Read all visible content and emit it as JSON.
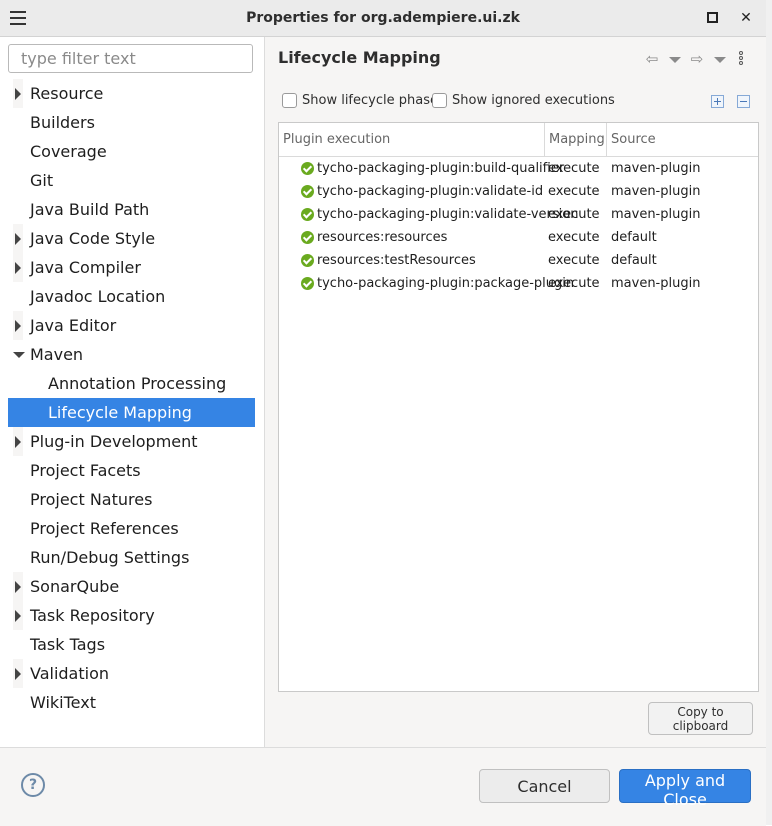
{
  "window": {
    "title": "Properties for org.adempiere.ui.zk",
    "menu_icon": "hamburger-icon",
    "maximize_icon": "maximize-icon",
    "close_icon": "close-icon",
    "close_glyph": "✕"
  },
  "sidebar": {
    "filter_placeholder": "type filter text",
    "items": [
      {
        "label": "Resource",
        "expander": "collapsed"
      },
      {
        "label": "Builders",
        "expander": "none"
      },
      {
        "label": "Coverage",
        "expander": "none"
      },
      {
        "label": "Git",
        "expander": "none"
      },
      {
        "label": "Java Build Path",
        "expander": "none"
      },
      {
        "label": "Java Code Style",
        "expander": "collapsed"
      },
      {
        "label": "Java Compiler",
        "expander": "collapsed"
      },
      {
        "label": "Javadoc Location",
        "expander": "none"
      },
      {
        "label": "Java Editor",
        "expander": "collapsed"
      },
      {
        "label": "Maven",
        "expander": "expanded"
      },
      {
        "label": "Annotation Processing",
        "expander": "none",
        "child": true
      },
      {
        "label": "Lifecycle Mapping",
        "expander": "none",
        "child": true,
        "selected": true
      },
      {
        "label": "Plug-in Development",
        "expander": "collapsed"
      },
      {
        "label": "Project Facets",
        "expander": "none"
      },
      {
        "label": "Project Natures",
        "expander": "none"
      },
      {
        "label": "Project References",
        "expander": "none"
      },
      {
        "label": "Run/Debug Settings",
        "expander": "none"
      },
      {
        "label": "SonarQube",
        "expander": "collapsed"
      },
      {
        "label": "Task Repository",
        "expander": "collapsed"
      },
      {
        "label": "Task Tags",
        "expander": "none"
      },
      {
        "label": "Validation",
        "expander": "collapsed"
      },
      {
        "label": "WikiText",
        "expander": "none"
      }
    ]
  },
  "page": {
    "title": "Lifecycle Mapping",
    "nav": {
      "back_icon": "back-arrow-icon",
      "forward_icon": "forward-arrow-icon",
      "back_glyph": "⇦",
      "forward_glyph": "⇨"
    },
    "options": {
      "show_lifecycle_phases": {
        "label": "Show lifecycle phases",
        "checked": false
      },
      "show_ignored_executions": {
        "label": "Show ignored executions",
        "checked": false
      }
    },
    "tools": {
      "expand_all_icon": "expand-all-icon",
      "collapse_all_icon": "collapse-all-icon"
    },
    "table": {
      "columns": [
        "Plugin execution",
        "Mapping",
        "Source"
      ],
      "rows": [
        {
          "execution": "tycho-packaging-plugin:build-qualifier",
          "mapping": "execute",
          "source": "maven-plugin"
        },
        {
          "execution": "tycho-packaging-plugin:validate-id",
          "mapping": "execute",
          "source": "maven-plugin"
        },
        {
          "execution": "tycho-packaging-plugin:validate-version",
          "mapping": "execute",
          "source": "maven-plugin"
        },
        {
          "execution": "resources:resources",
          "mapping": "execute",
          "source": "default"
        },
        {
          "execution": "resources:testResources",
          "mapping": "execute",
          "source": "default"
        },
        {
          "execution": "tycho-packaging-plugin:package-plugin",
          "mapping": "execute",
          "source": "maven-plugin"
        }
      ],
      "status_icon": "check-circle-icon",
      "status_color": "#6aaa1f"
    },
    "copy_button": "Copy to clipboard"
  },
  "footer": {
    "help_glyph": "?",
    "cancel": "Cancel",
    "apply": "Apply and Close",
    "accent_color": "#3584e4"
  }
}
